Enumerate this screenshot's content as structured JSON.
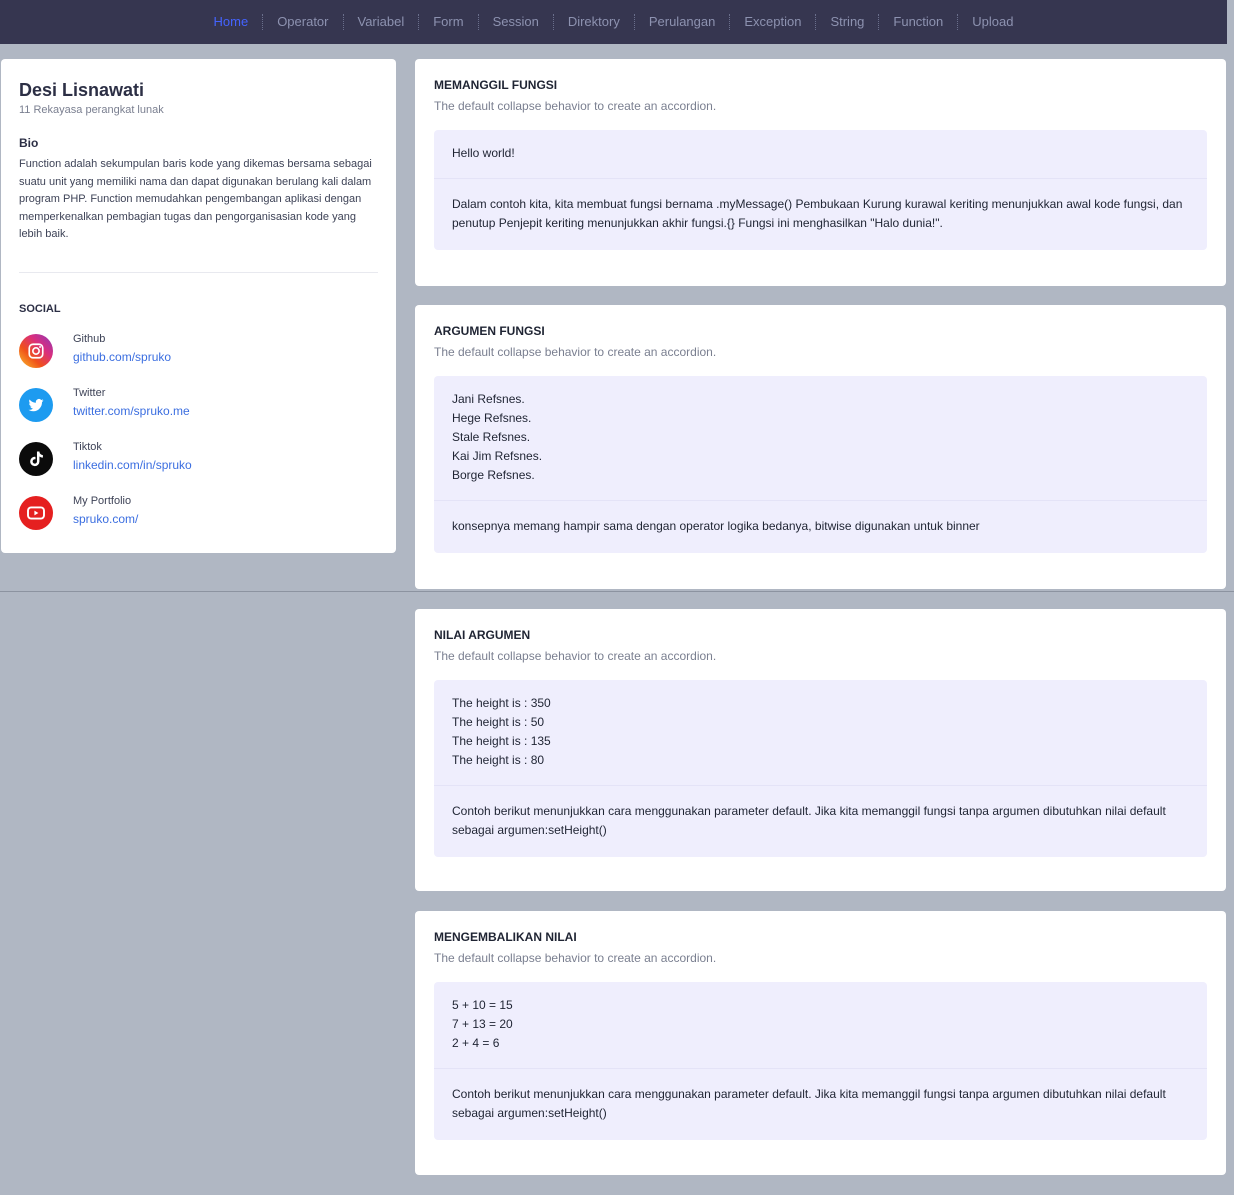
{
  "nav": [
    "Home",
    "Operator",
    "Variabel",
    "Form",
    "Session",
    "Direktory",
    "Perulangan",
    "Exception",
    "String",
    "Function",
    "Upload"
  ],
  "accent_color": "#4463ff",
  "profile": {
    "name": "Desi Lisnawati",
    "subtitle": "11 Rekayasa perangkat lunak",
    "bio_heading": "Bio",
    "bio": "Function adalah sekumpulan baris kode yang dikemas bersama sebagai suatu unit yang memiliki nama dan dapat digunakan berulang kali dalam program PHP. Function memudahkan pengembangan aplikasi dengan memperkenalkan pembagian tugas dan pengorganisasian kode yang lebih baik.",
    "social_heading": "SOCIAL",
    "social": [
      {
        "label": "Github",
        "link": "github.com/spruko",
        "icon": "instagram-icon"
      },
      {
        "label": "Twitter",
        "link": "twitter.com/spruko.me",
        "icon": "twitter-icon"
      },
      {
        "label": "Tiktok",
        "link": "linkedin.com/in/spruko",
        "icon": "tiktok-icon"
      },
      {
        "label": "My Portfolio",
        "link": "spruko.com/",
        "icon": "youtube-icon"
      }
    ]
  },
  "cards": [
    {
      "title": "MEMANGGIL FUNGSI",
      "subtitle": "The default collapse behavior to create an accordion.",
      "output": [
        "Hello world!"
      ],
      "description": "Dalam contoh kita, kita membuat fungsi bernama .myMessage() Pembukaan Kurung kurawal keriting menunjukkan awal kode fungsi, dan penutup Penjepit keriting menunjukkan akhir fungsi.{} Fungsi ini menghasilkan \"Halo dunia!\"."
    },
    {
      "title": "ARGUMEN FUNGSI",
      "subtitle": "The default collapse behavior to create an accordion.",
      "output": [
        "Jani Refsnes.",
        "Hege Refsnes.",
        "Stale Refsnes.",
        "Kai Jim Refsnes.",
        "Borge Refsnes."
      ],
      "description": "konsepnya memang hampir sama dengan operator logika bedanya, bitwise digunakan untuk binner"
    },
    {
      "title": "NILAI ARGUMEN",
      "subtitle": "The default collapse behavior to create an accordion.",
      "output": [
        "The height is : 350",
        "The height is : 50",
        "The height is : 135",
        "The height is : 80"
      ],
      "description": "Contoh berikut menunjukkan cara menggunakan parameter default. Jika kita memanggil fungsi tanpa argumen dibutuhkan nilai default sebagai argumen:setHeight()"
    },
    {
      "title": "MENGEMBALIKAN NILAI",
      "subtitle": "The default collapse behavior to create an accordion.",
      "output": [
        "5 + 10 = 15",
        "7 + 13 = 20",
        "2 + 4 = 6"
      ],
      "description": "Contoh berikut menunjukkan cara menggunakan parameter default. Jika kita memanggil fungsi tanpa argumen dibutuhkan nilai default sebagai argumen:setHeight()"
    }
  ]
}
